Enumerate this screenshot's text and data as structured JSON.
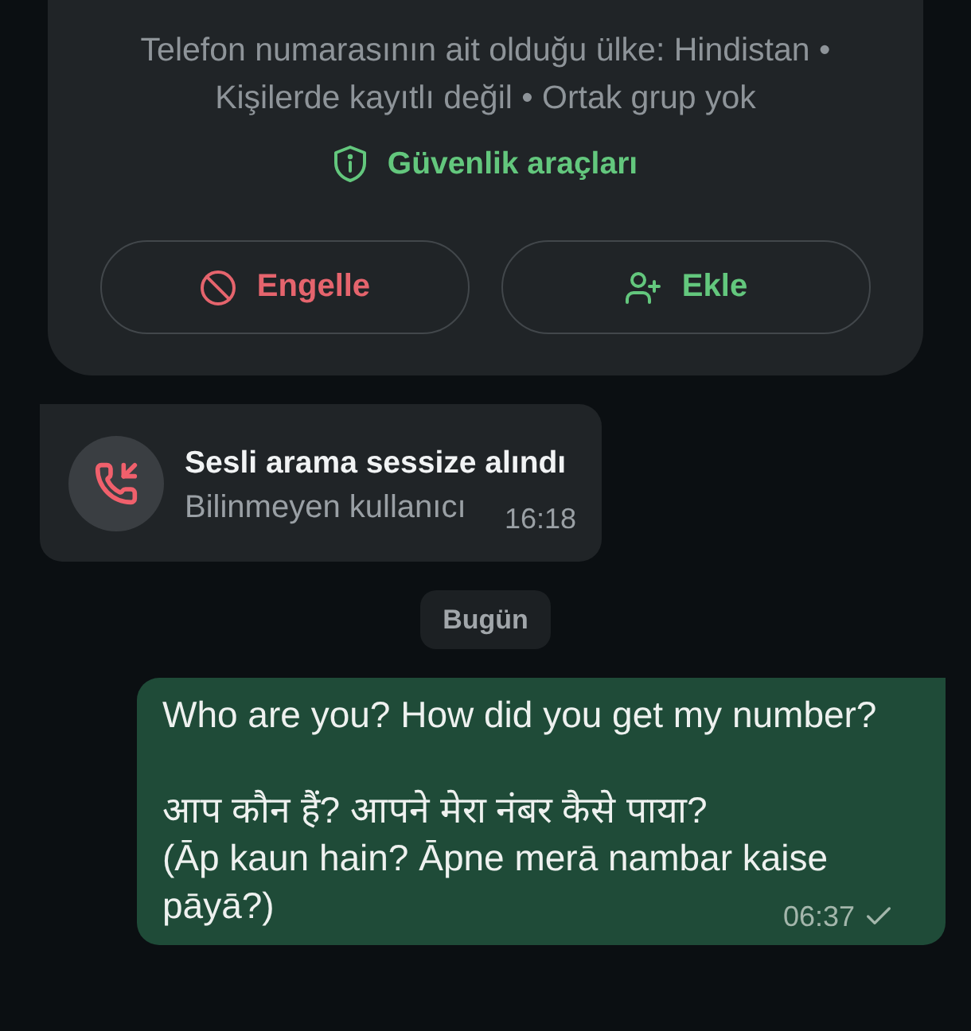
{
  "contact_card": {
    "info": "Telefon numarasının ait olduğu ülke: Hindistan • Kişilerde kayıtlı değil • Ortak grup yok",
    "safety_link": "Güvenlik araçları",
    "buttons": [
      {
        "kind": "block",
        "label": "Engelle"
      },
      {
        "kind": "add",
        "label": "Ekle"
      }
    ]
  },
  "call_notice": {
    "title": "Sesli arama sessize alındı",
    "subtitle": "Bilinmeyen kullanıcı",
    "time": "16:18"
  },
  "date_chip": "Bugün",
  "messages": [
    {
      "kind": "outgoing",
      "paragraphs": [
        [
          "Who are you? How did you get my number?"
        ],
        [
          "आप कौन हैं? आपने मेरा नंबर कैसे पाया?",
          "(Āp kaun hain? Āpne merā nambar kaise",
          "pāyā?)"
        ]
      ],
      "time": "06:37",
      "delivered": false
    }
  ]
}
